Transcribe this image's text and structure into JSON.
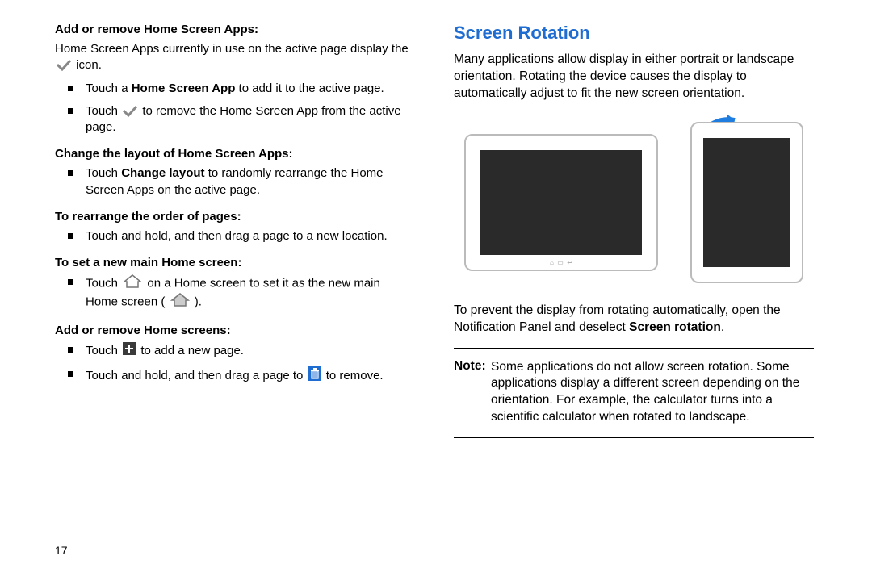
{
  "page_number": "17",
  "left": {
    "h1": "Add or remove Home Screen Apps:",
    "p1a": "Home Screen Apps currently in use on the active page display the ",
    "p1b": " icon.",
    "b1a_pre": "Touch a ",
    "b1a_bold": "Home Screen App",
    "b1a_post": " to add it to the active page.",
    "b1b_pre": "Touch ",
    "b1b_post": " to remove the Home Screen App from the active page.",
    "h2": "Change the layout of Home Screen Apps:",
    "b2_pre": "Touch ",
    "b2_bold": "Change layout",
    "b2_post": " to randomly rearrange the Home Screen Apps on the active page.",
    "h3": "To rearrange the order of pages:",
    "b3": "Touch and hold, and then drag a page to a new location.",
    "h4": "To set a new main Home screen:",
    "b4_pre": "Touch ",
    "b4_mid": " on a Home screen to set it as the new main Home screen (",
    "b4_post": ").",
    "h5": "Add or remove Home screens:",
    "b5a_pre": "Touch ",
    "b5a_post": " to add a new page.",
    "b5b_pre": "Touch and hold, and then drag a page to ",
    "b5b_post": " to remove."
  },
  "right": {
    "title": "Screen Rotation",
    "p1": "Many applications allow display in either portrait or landscape orientation. Rotating the device causes the display to automatically adjust to fit the new screen orientation.",
    "p2_pre": "To prevent the display from rotating automatically, open the Notification Panel and deselect ",
    "p2_bold": "Screen rotation",
    "p2_post": ".",
    "note_label": "Note:",
    "note_body": "Some applications do not allow screen rotation. Some applications display a different screen depending on the orientation. For example, the calculator turns into a scientific calculator when rotated to landscape."
  }
}
